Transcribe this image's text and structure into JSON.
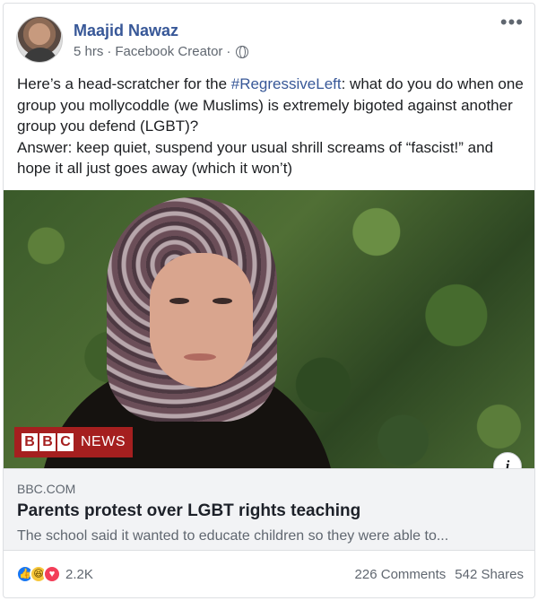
{
  "post": {
    "author": "Maajid Nawaz",
    "time": "5 hrs",
    "separator": "·",
    "source": "Facebook Creator",
    "separator2": "·",
    "more": "•••",
    "text_before_hashtag": "Here’s a head-scratcher for the ",
    "hashtag": "#RegressiveLeft",
    "text_after_hashtag": ": what do you do when one group you mollycoddle (we Muslims) is extremely bigoted against another group you defend (LGBT)?",
    "text_line2": "Answer: keep quiet, suspend your usual shrill screams of “fascist!” and hope it all just goes away (which it won’t)"
  },
  "media": {
    "logo_letters": [
      "B",
      "B",
      "C"
    ],
    "logo_word": "NEWS",
    "info": "i"
  },
  "link": {
    "domain": "BBC.COM",
    "title": "Parents protest over LGBT rights teaching",
    "description": "The school said it wanted to educate children so they were able to..."
  },
  "footer": {
    "reaction_icons": [
      "like-icon",
      "haha-icon",
      "love-icon"
    ],
    "reaction_count": "2.2K",
    "comments": "226 Comments",
    "shares": "542 Shares"
  },
  "colors": {
    "link_blue": "#385898",
    "bbc_red": "#a51f1f",
    "like_blue": "#1877f2",
    "love_red": "#f33e58",
    "haha_yellow": "#f7c73b"
  }
}
